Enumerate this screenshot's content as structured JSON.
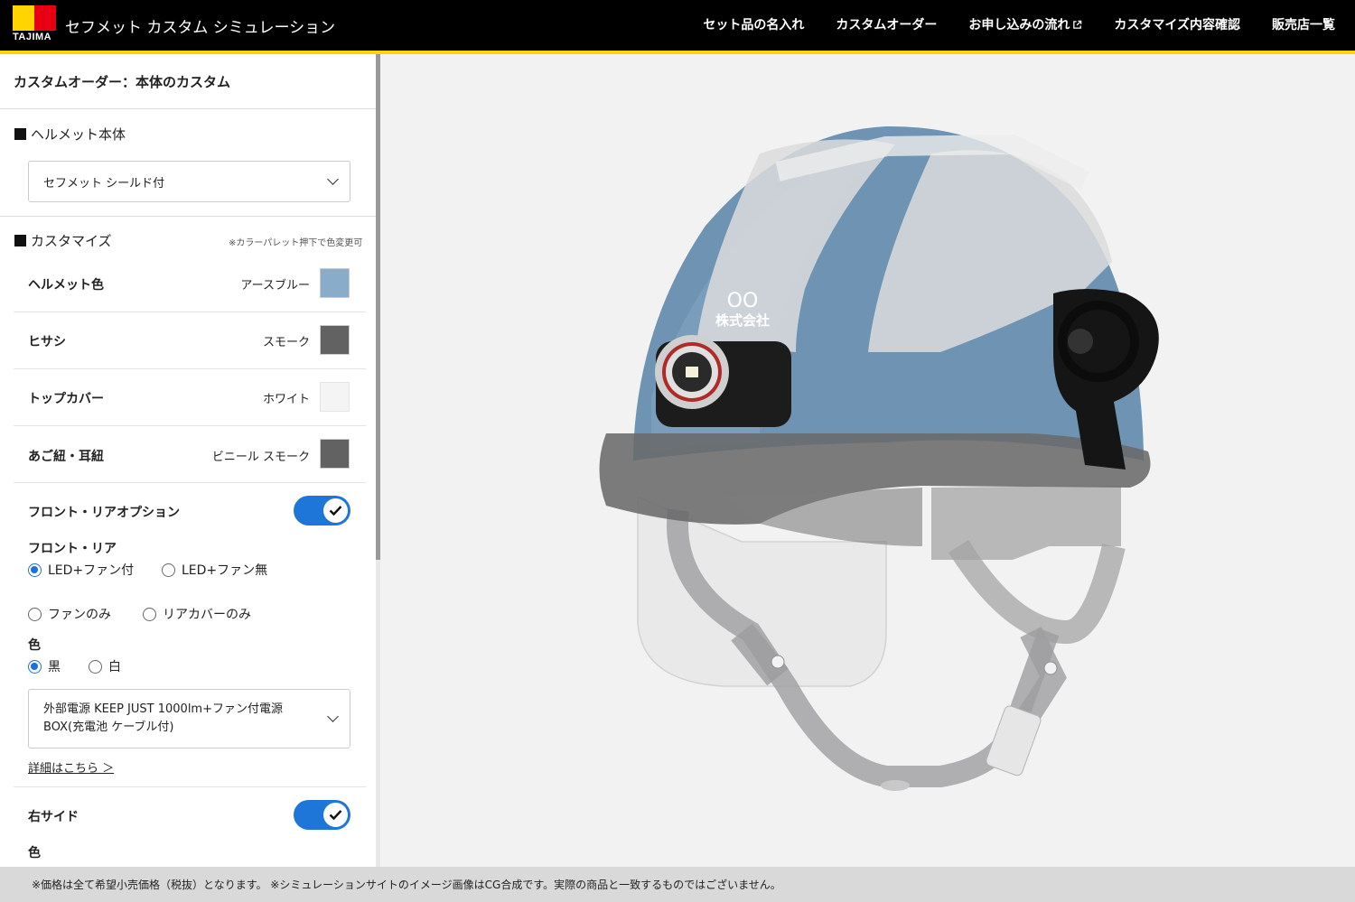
{
  "header": {
    "logo_text": "TAJIMA",
    "app_title": "セフメット カスタム シミュレーション",
    "nav": [
      {
        "label": "セット品の名入れ"
      },
      {
        "label": "カスタムオーダー"
      },
      {
        "label": "お申し込みの流れ"
      },
      {
        "label": "カスタマイズ内容確認"
      },
      {
        "label": "販売店一覧"
      }
    ]
  },
  "sidebar": {
    "title": "カスタムオーダー：本体のカスタム",
    "body_section": {
      "heading": "ヘルメット本体",
      "selected": "セフメット シールド付"
    },
    "customize": {
      "heading": "カスタマイズ",
      "note": "※カラーパレット押下で色変更可",
      "rows": [
        {
          "label": "ヘルメット色",
          "value": "アースブルー",
          "color": "#8aaccb"
        },
        {
          "label": "ヒサシ",
          "value": "スモーク",
          "color": "#636262"
        },
        {
          "label": "トップカバー",
          "value": "ホワイト",
          "color": "#f4f4f4"
        },
        {
          "label": "あご紐・耳紐",
          "value": "ビニール スモーク",
          "color": "#636262"
        }
      ]
    },
    "front_rear": {
      "toggle_label": "フロント・リアオプション",
      "enabled": true,
      "sub_label": "フロント・リア",
      "options": [
        "LED+ファン付",
        "LED+ファン無",
        "ファンのみ",
        "リアカバーのみ"
      ],
      "selected_option": "LED+ファン付",
      "color_label": "色",
      "colors": [
        "黒",
        "白"
      ],
      "selected_color": "黒",
      "product_line1": "外部電源 KEEP JUST 1000lm+ファン付電源",
      "product_line2": "BOX(充電池 ケーブル付)",
      "details_link": "詳細はこちら ＞"
    },
    "right_side": {
      "toggle_label": "右サイド",
      "enabled": true,
      "color_label": "色"
    }
  },
  "helmet_print": {
    "line1": "OO",
    "line2": "株式会社"
  },
  "footer": {
    "text": "※価格は全て希望小売価格（税抜）となります。 ※シミュレーションサイトのイメージ画像はCG合成です。実際の商品と一致するものではございません。"
  },
  "colors": {
    "header_bg": "#000000",
    "accent_yellow": "#ffd400",
    "logo_red": "#e60012",
    "toggle_blue": "#1e76d8",
    "helmet_blue": "#6f94b3"
  }
}
